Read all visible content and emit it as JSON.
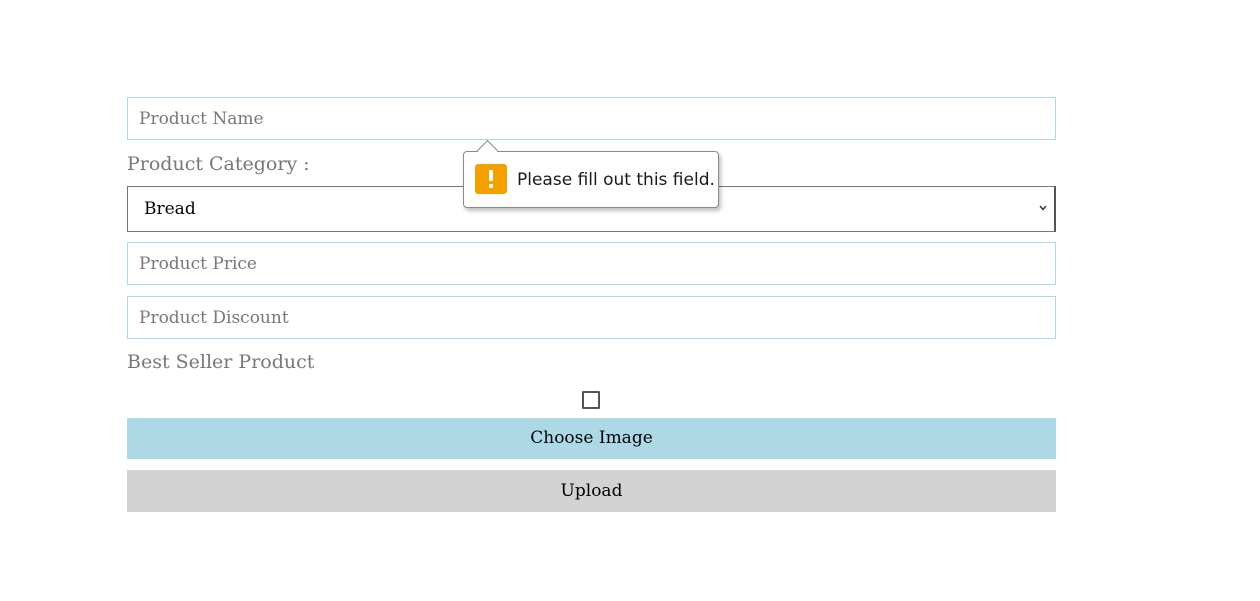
{
  "form": {
    "product_name_placeholder": "Product Name",
    "category_label": "Product Category :",
    "category_selected": "Bread",
    "price_placeholder": "Product Price",
    "discount_placeholder": "Product Discount",
    "best_seller_label": "Best Seller Product",
    "best_seller_checked": false,
    "choose_image_label": "Choose Image",
    "upload_label": "Upload"
  },
  "validation_tooltip": {
    "message": "Please fill out this field.",
    "icon": "warning-icon"
  },
  "colors": {
    "input_border": "#add8e6",
    "choose_button_bg": "#add8e6",
    "upload_button_bg": "#d3d3d3",
    "label_text": "#777777",
    "warning_icon_bg": "#f4a100"
  }
}
